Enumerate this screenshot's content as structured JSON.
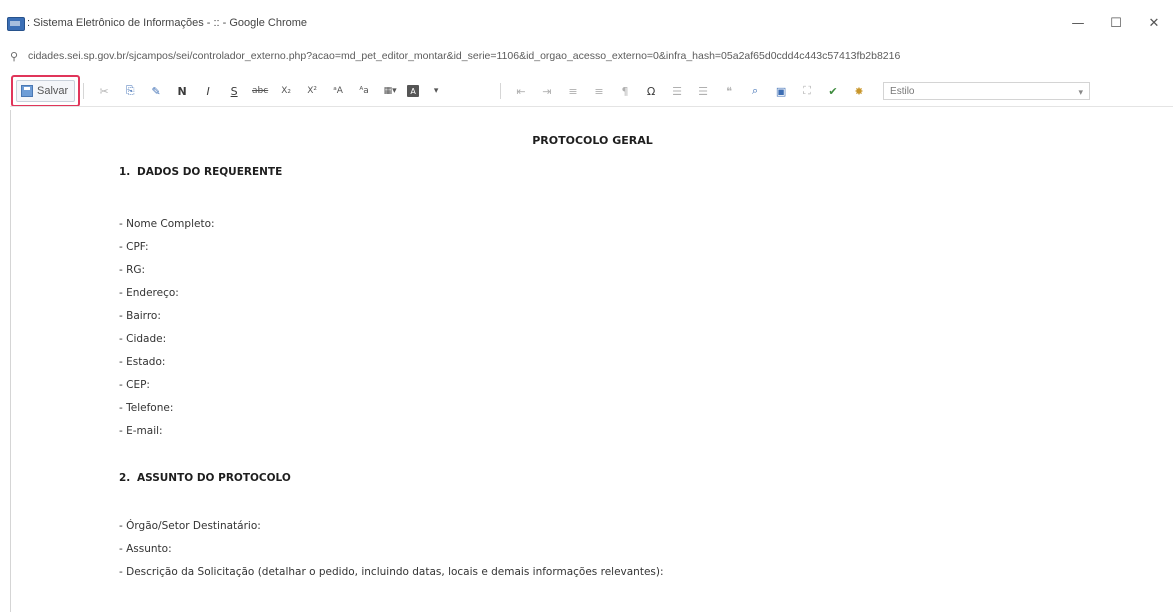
{
  "window": {
    "title": ": Sistema Eletrônico de Informações - :: - Google Chrome",
    "controls": {
      "minimize": "—",
      "maximize": "☐",
      "close": "✕"
    }
  },
  "address_bar": {
    "url": "cidades.sei.sp.gov.br/sjcampos/sei/controlador_externo.php?acao=md_pet_editor_montar&id_serie=1106&id_orgao_acesso_externo=0&infra_hash=05a2af65d0cdd4c443c57413fb2b8216"
  },
  "toolbar": {
    "save_label": "Salvar",
    "style_placeholder": "Estilo",
    "buttons": {
      "bold": "N",
      "italic": "I",
      "underline": "S",
      "strike": "abc",
      "subscript": "X₂",
      "superscript": "X²",
      "text_upper": "ᵃA",
      "text_lower": "ᴬa",
      "special_char": "Ω"
    }
  },
  "document": {
    "title": "PROTOCOLO GERAL",
    "section1": {
      "number": "1.",
      "heading": "DADOS DO REQUERENTE",
      "fields": [
        "- Nome Completo:",
        "- CPF:",
        "- RG:",
        "- Endereço:",
        "- Bairro:",
        "- Cidade:",
        "- Estado:",
        "- CEP:",
        "- Telefone:",
        "- E-mail:"
      ]
    },
    "section2": {
      "number": "2.",
      "heading": "ASSUNTO DO PROTOCOLO",
      "fields": [
        "- Órgão/Setor Destinatário:",
        "- Assunto:",
        "- Descrição da Solicitação (detalhar o pedido, incluindo datas, locais e demais informações relevantes):"
      ]
    }
  },
  "colors": {
    "highlight_box": "#e0355a",
    "save_icon": "#6e9dd6"
  }
}
